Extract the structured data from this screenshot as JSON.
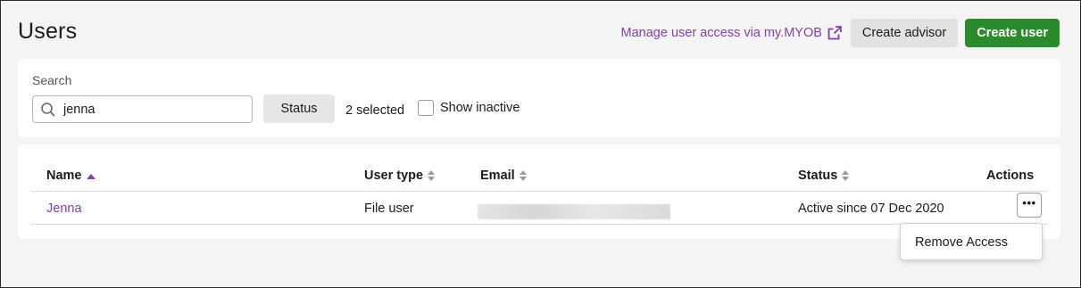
{
  "page": {
    "title": "Users"
  },
  "header": {
    "manage_link": "Manage user access via my.MYOB",
    "create_advisor": "Create advisor",
    "create_user": "Create user"
  },
  "filters": {
    "search_label": "Search",
    "search_value": "jenna",
    "status_button": "Status",
    "selected_text": "2 selected",
    "show_inactive": "Show inactive",
    "show_inactive_checked": false
  },
  "table": {
    "columns": [
      {
        "label": "Name",
        "sort": "asc"
      },
      {
        "label": "User type",
        "sort": "none"
      },
      {
        "label": "Email",
        "sort": "none"
      },
      {
        "label": "Status",
        "sort": "none"
      },
      {
        "label": "Actions"
      }
    ],
    "rows": [
      {
        "name": "Jenna",
        "user_type": "File user",
        "email": "",
        "status": "Active since 07 Dec 2020",
        "actions_glyph": "•••"
      }
    ]
  },
  "dropdown": {
    "items": [
      {
        "label": "Remove Access"
      }
    ]
  },
  "colors": {
    "accent": "#8241aa",
    "primary_button": "#2b8a2b",
    "secondary_button": "#e2e2e2"
  }
}
